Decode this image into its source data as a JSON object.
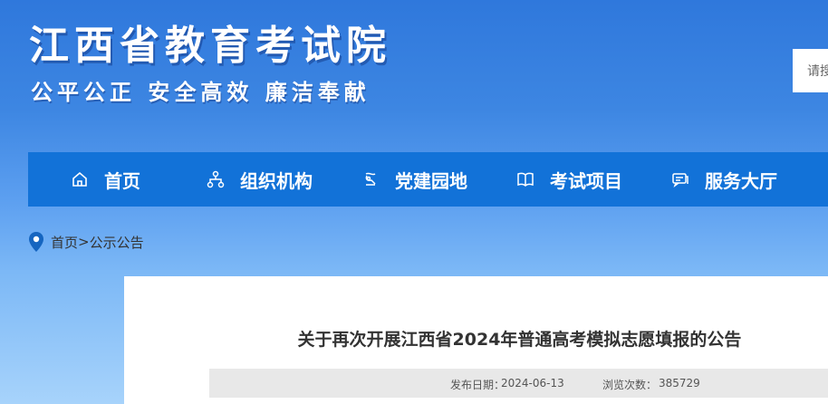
{
  "header": {
    "title": "江西省教育考试院",
    "slogan": "公平公正 安全高效 廉洁奉献",
    "search_placeholder": "请搜索"
  },
  "nav": {
    "items": [
      {
        "label": "首页",
        "icon": "home-icon"
      },
      {
        "label": "组织机构",
        "icon": "org-chart-icon"
      },
      {
        "label": "党建园地",
        "icon": "party-building-icon"
      },
      {
        "label": "考试项目",
        "icon": "book-icon"
      },
      {
        "label": "服务大厅",
        "icon": "chat-service-icon"
      }
    ]
  },
  "breadcrumb": {
    "icon": "location-pin-icon",
    "home": "首页",
    "separator": ">",
    "current": "公示公告"
  },
  "article": {
    "title": "关于再次开展江西省2024年普通高考模拟志愿填报的公告",
    "date_label": "发布日期：",
    "date": "2024-06-13",
    "views_label": "浏览次数：",
    "views": "385729"
  },
  "colors": {
    "nav_background": "#1272d8",
    "header_gradient_top": "#2f78dc",
    "page_gradient_bottom": "#a7d3fb",
    "breadcrumb_pin": "#1565c0"
  }
}
